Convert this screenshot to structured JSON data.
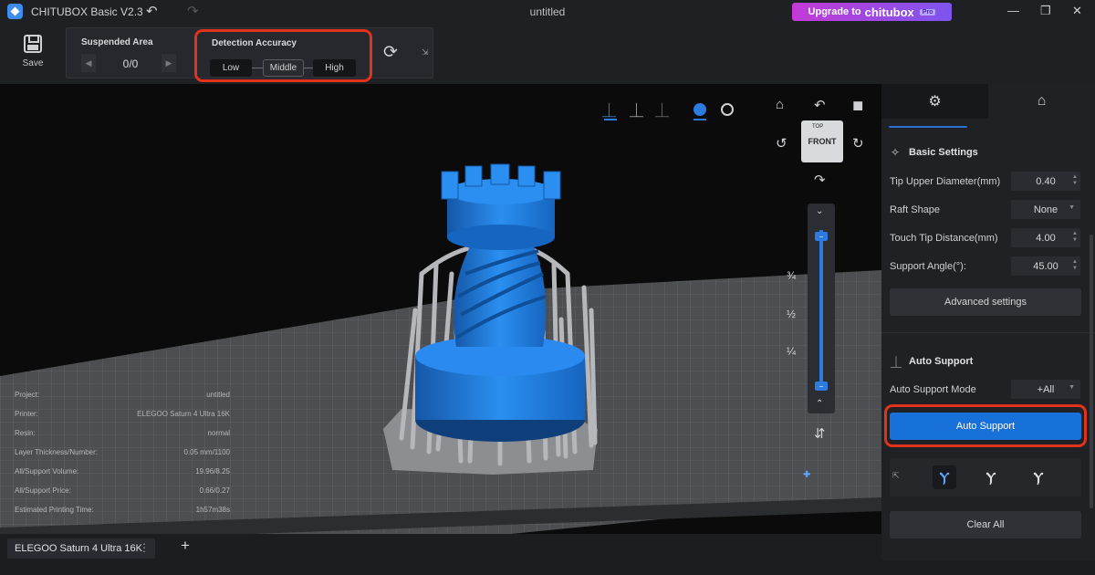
{
  "app": {
    "name": "CHITUBOX Basic V2.3",
    "document_title": "untitled"
  },
  "upgrade": {
    "label": "Upgrade to",
    "brand": "chitubox",
    "badge": "Pro"
  },
  "toolbar": {
    "save_label": "Save",
    "suspended_area": {
      "title": "Suspended Area",
      "count": "0/0"
    },
    "detection_accuracy": {
      "title": "Detection Accuracy",
      "options": [
        "Low",
        "Middle",
        "High"
      ],
      "selected": "Middle"
    }
  },
  "viewcube": {
    "front_label": "FRONT",
    "top_label": "TOP"
  },
  "layer_slider": {
    "marks": [
      "¾",
      "½",
      "¼"
    ]
  },
  "info": [
    {
      "key": "Project:",
      "value": "untitled"
    },
    {
      "key": "Printer:",
      "value": "ELEGOO Saturn 4 Ultra 16K"
    },
    {
      "key": "Resin:",
      "value": "normal"
    },
    {
      "key": "Layer Thickness/Number:",
      "value": "0.05 mm/1100"
    },
    {
      "key": "All/Support Volume:",
      "value": "19.96/8.25"
    },
    {
      "key": "All/Support Price:",
      "value": "0.66/0.27"
    },
    {
      "key": "Estimated Printing Time:",
      "value": "1h57m38s"
    }
  ],
  "printer_tab": {
    "label": "ELEGOO Saturn 4 Ultra 16K"
  },
  "basic_settings": {
    "title": "Basic Settings",
    "rows": [
      {
        "label": "Tip Upper Diameter(mm)",
        "value": "0.40"
      },
      {
        "label": "Raft Shape",
        "value": "None"
      },
      {
        "label": "Touch Tip Distance(mm)",
        "value": "4.00"
      },
      {
        "label": "Support Angle(°):",
        "value": "45.00"
      }
    ],
    "advanced_label": "Advanced settings"
  },
  "auto_support": {
    "title": "Auto Support",
    "mode_label": "Auto Support Mode",
    "mode_value": "+All",
    "button_label": "Auto Support",
    "clear_label": "Clear All"
  },
  "colors": {
    "accent": "#1870d9",
    "highlight": "#e1331c",
    "model": "#1f7fd6",
    "support": "#a9abb0"
  }
}
